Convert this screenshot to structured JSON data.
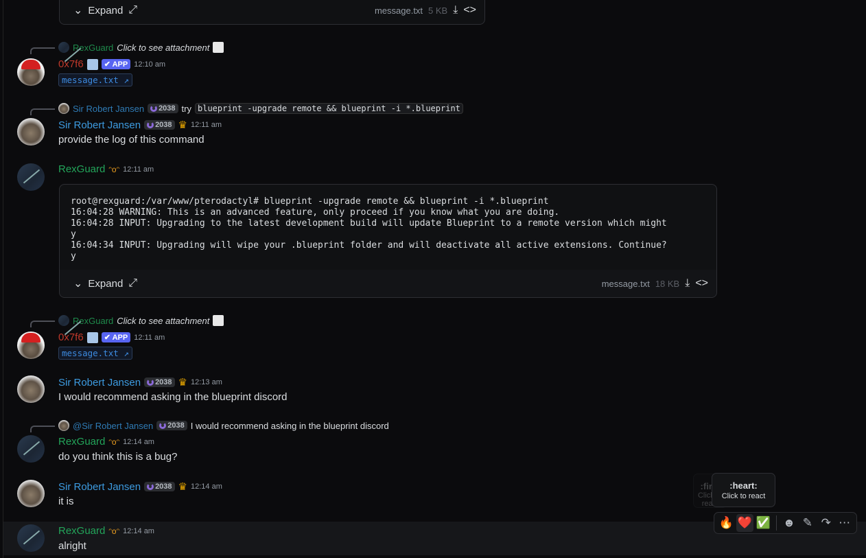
{
  "top_attachment": {
    "expand": "Expand",
    "filename": "message.txt",
    "size": "5 KB"
  },
  "messages": [
    {
      "reply": {
        "author": "RexGuard",
        "text": "Click to see attachment"
      },
      "author": "0x7f6",
      "badge": "APP",
      "time": "12:10 am",
      "attachment": "message.txt"
    },
    {
      "reply": {
        "author": "Sir Robert Jansen",
        "tag": "2038",
        "text": "try",
        "code": "blueprint -upgrade remote && blueprint -i *.blueprint"
      },
      "author": "Sir Robert Jansen",
      "tag": "2038",
      "time": "12:11 am",
      "text": "provide the log of this command"
    },
    {
      "author": "RexGuard",
      "time": "12:11 am",
      "log": "root@rexguard:/var/www/pterodactyl# blueprint -upgrade remote && blueprint -i *.blueprint\n16:04:28 WARNING: This is an advanced feature, only proceed if you know what you are doing.\n16:04:28 INPUT: Upgrading to the latest development build will update Blueprint to a remote version which might\ny\n16:04:34 INPUT: Upgrading will wipe your .blueprint folder and will deactivate all active extensions. Continue?\ny",
      "expand": "Expand",
      "filename": "message.txt",
      "size": "18 KB"
    },
    {
      "reply": {
        "author": "RexGuard",
        "text": "Click to see attachment"
      },
      "author": "0x7f6",
      "badge": "APP",
      "time": "12:11 am",
      "attachment": "message.txt"
    },
    {
      "author": "Sir Robert Jansen",
      "tag": "2038",
      "time": "12:13 am",
      "text": "I would recommend asking in the blueprint discord"
    },
    {
      "reply": {
        "author": "@Sir Robert Jansen",
        "tag": "2038",
        "text": "I would recommend asking in the blueprint discord"
      },
      "author": "RexGuard",
      "time": "12:14 am",
      "text": "do you think this is a bug?"
    },
    {
      "author": "Sir Robert Jansen",
      "tag": "2038",
      "time": "12:14 am",
      "text": "it is"
    },
    {
      "author": "RexGuard",
      "time": "12:14 am",
      "text": "alright"
    }
  ],
  "toolbar": {
    "tooltip_title": ":heart:",
    "tooltip_sub": "Click to react",
    "faded_tooltip": ":fire:",
    "faded_sub": "Click to react",
    "reactions": [
      "🔥",
      "❤️",
      "✅"
    ]
  }
}
